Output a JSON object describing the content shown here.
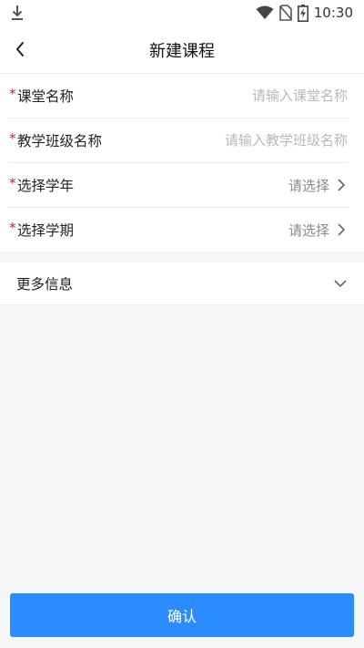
{
  "status_bar": {
    "time": "10:30"
  },
  "header": {
    "title": "新建课程"
  },
  "form": {
    "classroom_name": {
      "label": "课堂名称",
      "placeholder": "请输入课堂名称",
      "value": ""
    },
    "class_name": {
      "label": "教学班级名称",
      "placeholder": "请输入教学班级名称",
      "value": ""
    },
    "school_year": {
      "label": "选择学年",
      "value": "请选择"
    },
    "semester": {
      "label": "选择学期",
      "value": "请选择"
    },
    "required_mark": "*"
  },
  "more_info": {
    "label": "更多信息"
  },
  "footer": {
    "confirm_label": "确认"
  },
  "colors": {
    "accent": "#2a8cff",
    "required": "#e02020",
    "background": "#f5f6f8"
  },
  "icons": [
    "download-icon",
    "wifi-icon",
    "no-sim-icon",
    "battery-charging-icon",
    "back-arrow-icon",
    "chevron-right-icon",
    "chevron-down-icon"
  ]
}
